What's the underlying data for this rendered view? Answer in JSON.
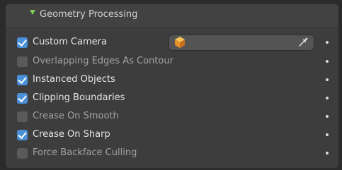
{
  "panel": {
    "title": "Geometry Processing",
    "toggle_icon": "disclosure-triangle-down-icon"
  },
  "options": [
    {
      "label": "Custom Camera",
      "checked": true
    },
    {
      "label": "Overlapping Edges As Contour",
      "checked": false
    },
    {
      "label": "Instanced Objects",
      "checked": true
    },
    {
      "label": "Clipping Boundaries",
      "checked": true
    },
    {
      "label": "Crease On Smooth",
      "checked": false
    },
    {
      "label": "Crease On Sharp",
      "checked": true
    },
    {
      "label": "Force Backface Culling",
      "checked": false
    }
  ],
  "camera_field": {
    "value": "",
    "object_icon": "object-cube-icon",
    "picker_icon": "eyedropper-icon"
  },
  "colors": {
    "checkbox_checked": "#4a90d9",
    "toggle_arrow": "#7fcf57",
    "object_icon": "#f0a030"
  }
}
